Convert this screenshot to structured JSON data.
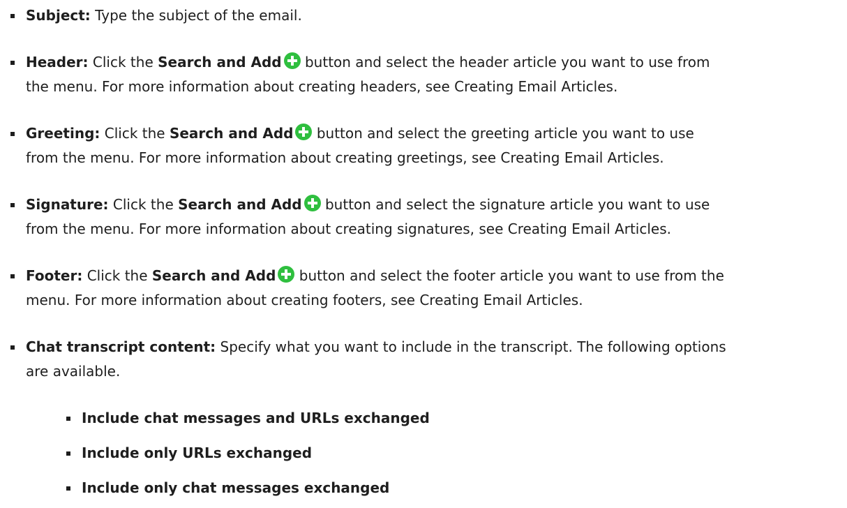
{
  "items": [
    {
      "label": "Subject:",
      "text": "Type the subject of the email."
    },
    {
      "label": "Header:",
      "pre": "Click the",
      "button": "Search and Add",
      "post": "button and select the header article you want to use from",
      "line2": "the menu. For more information about creating headers, see Creating Email Articles."
    },
    {
      "label": "Greeting:",
      "pre": "Click the",
      "button": "Search and Add",
      "post": "button and select the greeting article you want to use",
      "line2": "from the menu. For more information about creating greetings, see Creating Email Articles."
    },
    {
      "label": "Signature:",
      "pre": "Click the",
      "button": "Search and Add",
      "post": "button and select the signature article you want to use",
      "line2": "from the menu. For more information about creating signatures, see Creating Email Articles."
    },
    {
      "label": "Footer:",
      "pre": "Click the",
      "button": "Search and Add",
      "post": "button and select the footer article you want to use from the",
      "line2": "menu. For more information about creating footers, see Creating Email Articles."
    },
    {
      "label": "Chat transcript content:",
      "text": "Specify what you want to include in the transcript. The following options",
      "line2": "are available."
    }
  ],
  "subitems": [
    "Include chat messages and URLs exchanged",
    "Include only URLs exchanged",
    "Include only chat messages exchanged"
  ],
  "icon": {
    "name": "add-circle-icon",
    "color": "#2fbf3f"
  }
}
